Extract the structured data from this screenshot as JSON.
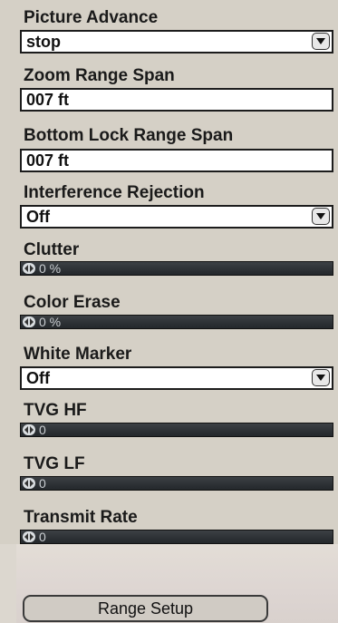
{
  "fields": {
    "picture_advance": {
      "label": "Picture Advance",
      "value": "stop"
    },
    "zoom_range_span": {
      "label": "Zoom Range Span",
      "value": "007 ft"
    },
    "bottom_lock_range_span": {
      "label": "Bottom Lock Range Span",
      "value": "007 ft"
    },
    "interference_rejection": {
      "label": "Interference Rejection",
      "value": "Off"
    },
    "clutter": {
      "label": "Clutter",
      "value_text": "0 %",
      "level_percent": 0
    },
    "color_erase": {
      "label": "Color Erase",
      "value_text": "0 %",
      "level_percent": 0
    },
    "white_marker": {
      "label": "White Marker",
      "value": "Off"
    },
    "tvg_hf": {
      "label": "TVG HF",
      "value_text": "0",
      "level_percent": 0
    },
    "tvg_lf": {
      "label": "TVG LF",
      "value_text": "0",
      "level_percent": 0
    },
    "transmit_rate": {
      "label": "Transmit Rate",
      "value_text": "0",
      "level_percent": 0
    }
  },
  "range_setup_button": {
    "label": "Range Setup"
  },
  "icons": {
    "dropdown": "chevron-down-icon",
    "slider_knob": "slider-knob-icon"
  }
}
